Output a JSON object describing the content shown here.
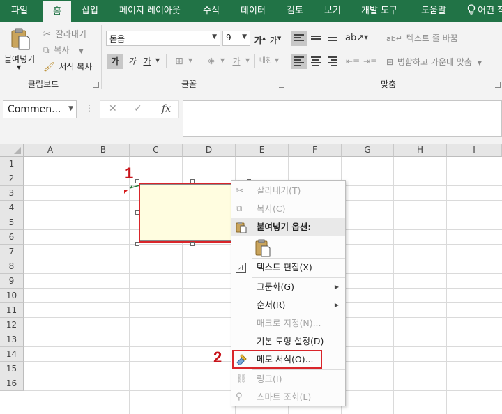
{
  "tabs": [
    "파일",
    "홈",
    "삽입",
    "페이지 레이아웃",
    "수식",
    "데이터",
    "검토",
    "보기",
    "개발 도구",
    "도움말",
    "어떤 작"
  ],
  "active_tab": "홈",
  "clipboard": {
    "paste_label": "붙여넣기",
    "cut_label": "잘라내기",
    "copy_label": "복사",
    "format_painter_label": "서식 복사",
    "group_label": "클립보드"
  },
  "font": {
    "name": "돋움",
    "size": "9",
    "bold": "가",
    "italic": "가",
    "underline": "가",
    "group_label": "글꼴"
  },
  "alignment": {
    "wrap_text_label": "텍스트 줄 바꿈",
    "merge_center_label": "병합하고 가운데 맞춤",
    "group_label": "맞춤"
  },
  "formula_bar": {
    "name_box": "Commen...",
    "cancel_glyph": "✕",
    "enter_glyph": "✓",
    "fx_glyph": "fx",
    "value": ""
  },
  "columns": [
    "A",
    "B",
    "C",
    "D",
    "E",
    "F",
    "G",
    "H",
    "I"
  ],
  "rows": [
    "1",
    "2",
    "3",
    "4",
    "5",
    "6",
    "7",
    "8",
    "9",
    "10",
    "11",
    "12",
    "13",
    "14",
    "15",
    "16"
  ],
  "callouts": {
    "step1": "1",
    "step2": "2"
  },
  "context_menu": {
    "items": [
      {
        "label": "잘라내기(T)",
        "disabled": true
      },
      {
        "label": "복사(C)",
        "disabled": true
      },
      {
        "label": "붙여넣기 옵션:",
        "disabled": false
      },
      {
        "label": "텍스트 편집(X)",
        "disabled": false
      },
      {
        "label": "그룹화(G)",
        "disabled": false
      },
      {
        "label": "순서(R)",
        "disabled": false
      },
      {
        "label": "매크로 지정(N)...",
        "disabled": true
      },
      {
        "label": "기본 도형 설정(D)",
        "disabled": false
      },
      {
        "label": "메모 서식(O)...",
        "disabled": false
      },
      {
        "label": "링크(I)",
        "disabled": true
      },
      {
        "label": "스마트 조회(L)",
        "disabled": true
      }
    ]
  },
  "colors": {
    "excel_green": "#217346",
    "callout_red": "#c8131a",
    "comment_fill": "#fffde0"
  }
}
